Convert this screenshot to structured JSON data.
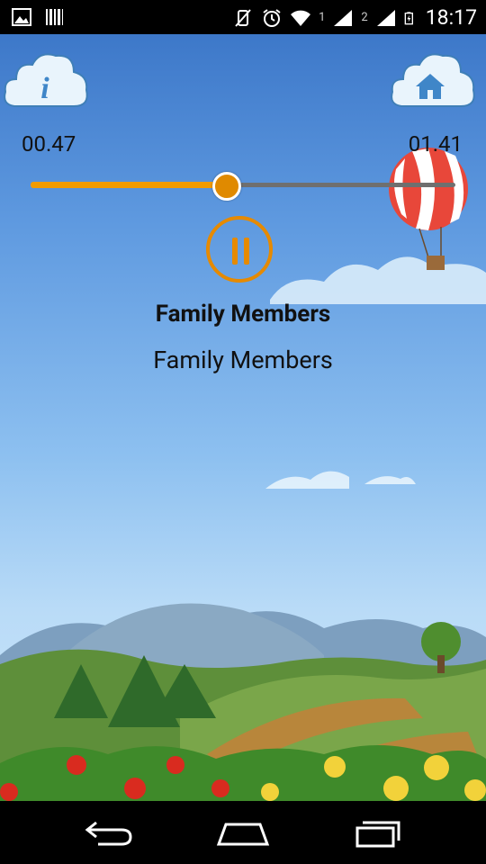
{
  "status_bar": {
    "time": "18:17",
    "sim1_label": "1",
    "sim2_label": "2",
    "left_icons": [
      "image-icon",
      "barcode-icon"
    ],
    "right_icons": [
      "vibrate-icon",
      "alarm-icon",
      "wifi-icon",
      "signal-icon",
      "battery-icon"
    ]
  },
  "header": {
    "info_button_icon": "info-icon",
    "home_button_icon": "home-icon"
  },
  "player": {
    "elapsed": "00.47",
    "total": "01.41",
    "progress": 0.46,
    "state": "playing",
    "accent_color": "#e68a00"
  },
  "track": {
    "title": "Family Members",
    "subtitle": "Family Members"
  },
  "nav": {
    "back_icon": "back-icon",
    "home_icon": "home-outline-icon",
    "recents_icon": "recents-icon"
  }
}
